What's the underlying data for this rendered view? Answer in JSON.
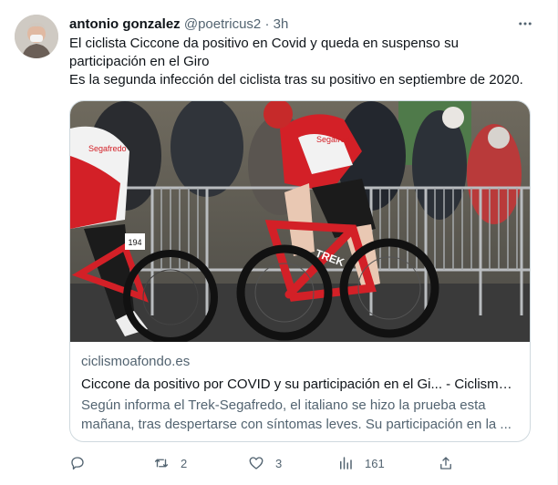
{
  "tweet": {
    "author_name": "antonio gonzalez",
    "author_handle": "@poetricus2",
    "separator": "·",
    "time": "3h",
    "text_lines": [
      "El ciclista Ciccone da positivo en Covid y queda en suspenso su",
      "participación en el Giro",
      "Es la segunda infección del ciclista tras su positivo en septiembre de 2020."
    ]
  },
  "card": {
    "domain": "ciclismoafondo.es",
    "title": "Ciccone da positivo por COVID y su participación en el Gi... - Ciclismo ...",
    "description": "Según informa el Trek-Segafredo, el italiano se hizo la prueba esta mañana, tras despertarse con síntomas leves. Su participación en la ...",
    "image_text": {
      "jersey_brand_left": "Segafredo",
      "jersey_brand_right": "Segafredo",
      "bike_brand": "TREK",
      "race_number": "194"
    }
  },
  "actions": {
    "reply_count": "",
    "retweet_count": "2",
    "like_count": "3",
    "views_count": "161"
  },
  "icons": {
    "more": "more-horizontal-icon",
    "reply": "reply-icon",
    "retweet": "retweet-icon",
    "like": "heart-icon",
    "views": "views-icon",
    "share": "share-icon"
  },
  "colors": {
    "text_primary": "#0f1419",
    "text_secondary": "#536471",
    "border": "#cfd9de",
    "jersey_red": "#d32027",
    "jersey_white": "#f2f2f2"
  }
}
